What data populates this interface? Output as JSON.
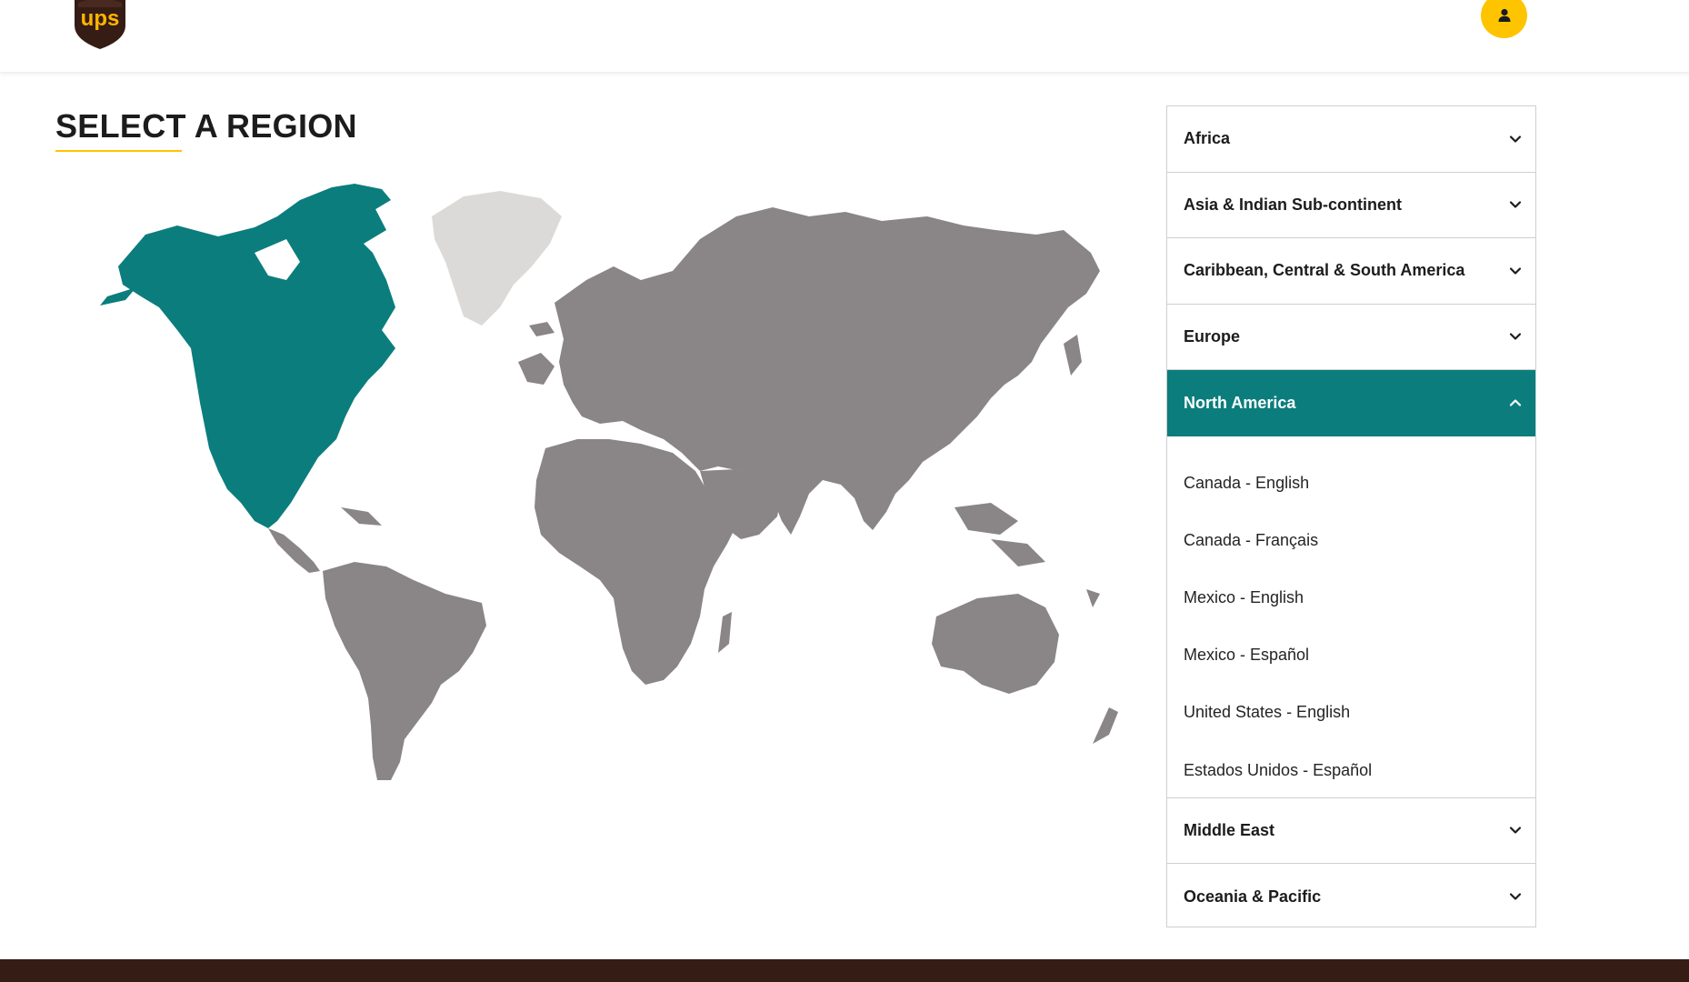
{
  "brand": {
    "logo_text": "ups",
    "logo_color": "#351c15",
    "logo_accent": "#ffb500"
  },
  "header": {
    "profile_icon": "user-icon",
    "profile_color": "#ffc400"
  },
  "page": {
    "title": "SELECT A REGION"
  },
  "map": {
    "highlight_region": "North America",
    "highlight_color": "#0b7d7d",
    "default_color": "#8a8586",
    "greenland_color": "#dcdad8"
  },
  "regions": [
    {
      "label": "Africa",
      "expanded": false
    },
    {
      "label": "Asia & Indian Sub-continent",
      "expanded": false
    },
    {
      "label": "Caribbean, Central & South America",
      "expanded": false
    },
    {
      "label": "Europe",
      "expanded": false
    },
    {
      "label": "North America",
      "expanded": true,
      "countries": [
        "Canada - English",
        "Canada - Français",
        "Mexico - English",
        "Mexico - Español",
        "United States - English",
        "Estados Unidos - Español"
      ]
    },
    {
      "label": "Middle East",
      "expanded": false
    },
    {
      "label": "Oceania & Pacific",
      "expanded": false
    }
  ],
  "colors": {
    "accent": "#0b7d7d",
    "yellow": "#ffc400",
    "footer": "#351c15"
  }
}
